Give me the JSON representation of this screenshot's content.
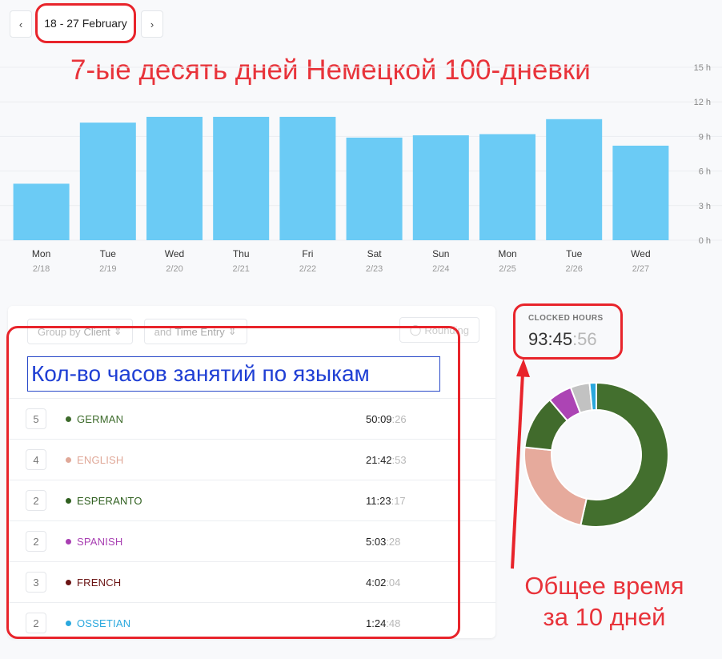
{
  "date_nav": {
    "prev_icon": "chevron-left-icon",
    "next_icon": "chevron-right-icon",
    "range": "18 - 27 February"
  },
  "annotations": {
    "title": "7-ые десять дней Немецкой 100-дневки",
    "table_heading": "Кол-во часов занятий по языкам",
    "total_line1": "Общее время",
    "total_line2": "за 10 дней"
  },
  "chart_data": {
    "type": "bar",
    "categories": [
      "Mon",
      "Tue",
      "Wed",
      "Thu",
      "Fri",
      "Sat",
      "Sun",
      "Mon",
      "Tue",
      "Wed"
    ],
    "dates": [
      "2/18",
      "2/19",
      "2/20",
      "2/21",
      "2/22",
      "2/23",
      "2/24",
      "2/25",
      "2/26",
      "2/27"
    ],
    "values": [
      4.9,
      10.2,
      10.7,
      10.7,
      10.7,
      8.9,
      9.1,
      9.2,
      10.5,
      8.2
    ],
    "y_ticks": [
      "15 h",
      "12 h",
      "9 h",
      "6 h",
      "3 h",
      "0 h"
    ],
    "ylim": [
      0,
      15
    ],
    "grid": true,
    "bar_color": "#6bcbf5"
  },
  "controls": {
    "group_prefix": "Group by",
    "group_value": "Client",
    "sub_prefix": "and",
    "sub_value": "Time Entry",
    "rounding": "Rounding"
  },
  "rows": [
    {
      "count": "5",
      "name": "GERMAN",
      "color": "#3d6b2b",
      "time_main": "50:09",
      "time_sec": ":26"
    },
    {
      "count": "4",
      "name": "ENGLISH",
      "color": "#e0a898",
      "time_main": "21:42",
      "time_sec": ":53"
    },
    {
      "count": "2",
      "name": "ESPERANTO",
      "color": "#2f5f1f",
      "time_main": "11:23",
      "time_sec": ":17"
    },
    {
      "count": "2",
      "name": "SPANISH",
      "color": "#a83fb2",
      "time_main": "5:03",
      "time_sec": ":28"
    },
    {
      "count": "3",
      "name": "FRENCH",
      "color": "#6b1414",
      "time_main": "4:02",
      "time_sec": ":04"
    },
    {
      "count": "2",
      "name": "OSSETIAN",
      "color": "#2aa8de",
      "time_main": "1:24",
      "time_sec": ":48"
    }
  ],
  "clocked": {
    "label": "CLOCKED HOURS",
    "main": "93:45",
    "sec": ":56"
  },
  "donut": {
    "hours": [
      50.16,
      21.71,
      11.39,
      5.06,
      4.03,
      1.41
    ],
    "colors": [
      "#436f2e",
      "#e6aa9c",
      "#416b2c",
      "#ac44b4",
      "#c2c2c2",
      "#2aa8de"
    ]
  }
}
